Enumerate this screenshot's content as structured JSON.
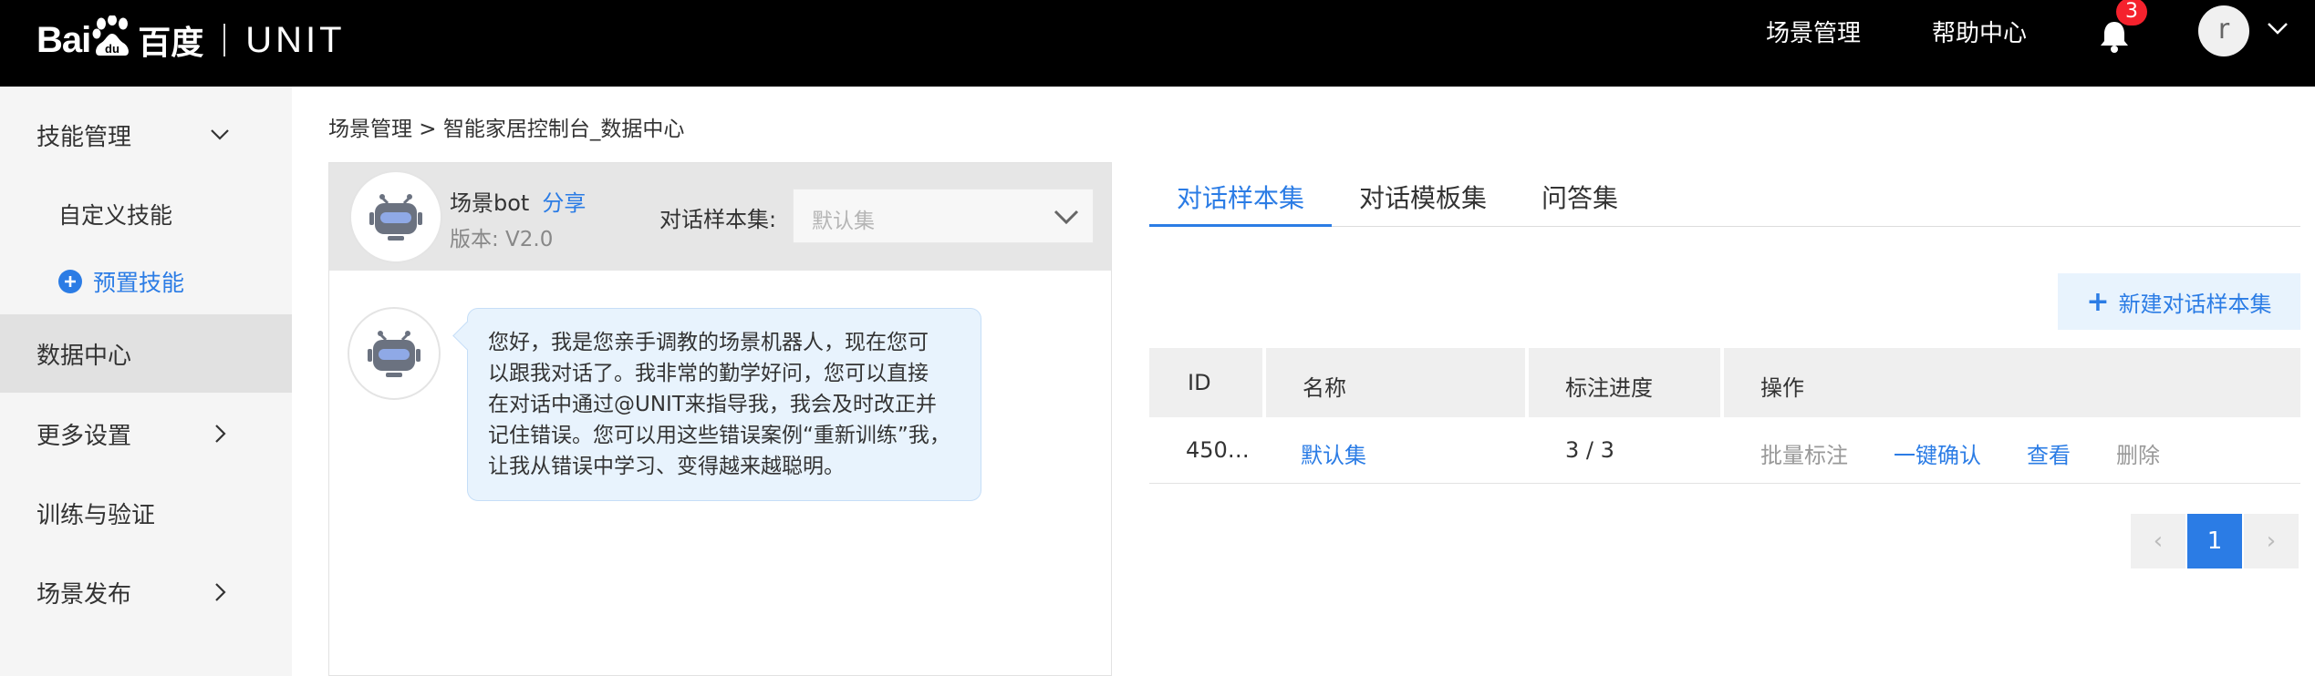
{
  "header": {
    "logo_latin": "Bai",
    "logo_du": "du",
    "logo_cn": "百度",
    "product": "UNIT",
    "nav": [
      "场景管理",
      "帮助中心"
    ],
    "notification_count": "3",
    "avatar_letter": "r"
  },
  "sidebar": {
    "skill_management": "技能管理",
    "custom_skill": "自定义技能",
    "preset_skill": "预置技能",
    "data_center": "数据中心",
    "more_settings": "更多设置",
    "train_verify": "训练与验证",
    "scene_publish": "场景发布"
  },
  "breadcrumb": "场景管理 > 智能家居控制台_数据中心",
  "chat": {
    "bot_name": "场景bot",
    "share": "分享",
    "version": "版本: V2.0",
    "sample_set_label": "对话样本集:",
    "sample_set_placeholder": "默认集",
    "message_lines": [
      "您好，我是您亲手调教的场景机器人，现在您可",
      "以跟我对话了。我非常的勤学好问，您可以直接",
      "在对话中通过@UNIT来指导我，我会及时改正并",
      "记住错误。您可以用这些错误案例“重新训练”我，",
      "让我从错误中学习、变得越来越聪明。"
    ]
  },
  "tabs": [
    "对话样本集",
    "对话模板集",
    "问答集"
  ],
  "new_button": "新建对话样本集",
  "table": {
    "headers": [
      "ID",
      "名称",
      "标注进度",
      "操作"
    ],
    "rows": [
      {
        "id": "450…",
        "name": "默认集",
        "progress": "3 / 3",
        "actions": [
          "批量标注",
          "一键确认",
          "查看",
          "删除"
        ]
      }
    ]
  },
  "pagination": {
    "prev": "‹",
    "current": "1",
    "next": "›"
  },
  "colors": {
    "accent": "#2b7ce5",
    "topbar": "#000000",
    "badge": "#f5222d"
  }
}
